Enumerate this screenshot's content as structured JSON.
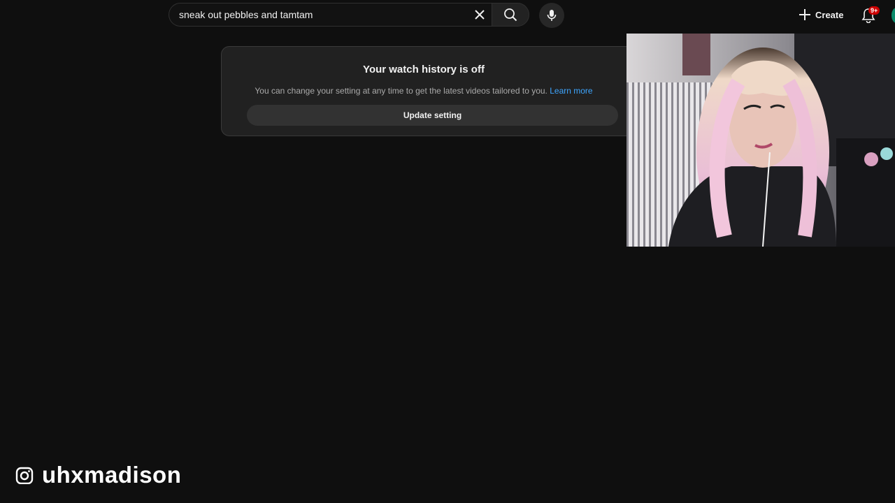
{
  "search": {
    "value": "sneak out pebbles and tamtam",
    "clear_icon": "close-icon",
    "search_icon": "search-icon",
    "mic_icon": "microphone-icon"
  },
  "header": {
    "create_label": "Create",
    "notification_badge": "9+"
  },
  "history_notice": {
    "title": "Your watch history is off",
    "description": "You can change your setting at any time to get the latest videos tailored to you.",
    "learn_more": "Learn more",
    "update_button": "Update setting"
  },
  "colors": {
    "background": "#0f0f0f",
    "card": "#212121",
    "link": "#3ea6ff",
    "badge": "#cc0000"
  },
  "overlay": {
    "social_icon": "instagram-icon",
    "handle": "uhxmadison"
  }
}
